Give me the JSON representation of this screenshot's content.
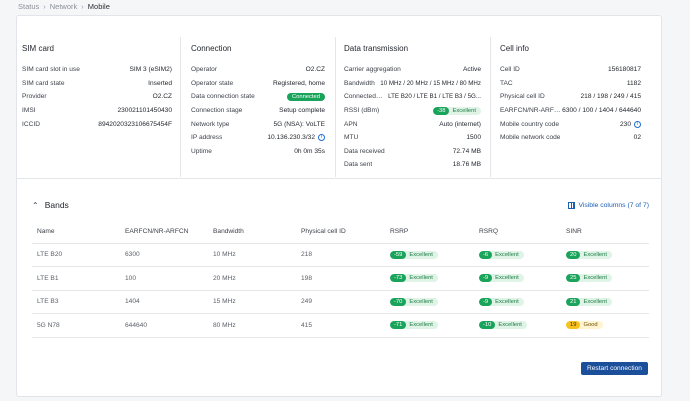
{
  "breadcrumb": [
    "Status",
    "Network",
    "Mobile"
  ],
  "sim": {
    "title": "SIM card",
    "rows": [
      {
        "k": "SIM card slot in use",
        "v": "SIM 3 (eSIM2)"
      },
      {
        "k": "SIM card state",
        "v": "Inserted"
      },
      {
        "k": "Provider",
        "v": "O2.CZ"
      },
      {
        "k": "IMSI",
        "v": "230021101450430"
      },
      {
        "k": "ICCID",
        "v": "8942020323106675454F"
      }
    ]
  },
  "connection": {
    "title": "Connection",
    "rows": [
      {
        "k": "Operator",
        "v": "O2.CZ"
      },
      {
        "k": "Operator state",
        "v": "Registered, home"
      },
      {
        "k": "Data connection state",
        "v": "Connected"
      },
      {
        "k": "Connection stage",
        "v": "Setup complete"
      },
      {
        "k": "Network type",
        "v": "5G (NSA): VoLTE"
      },
      {
        "k": "IP address",
        "v": "10.136.230.3/32"
      },
      {
        "k": "Uptime",
        "v": "0h 0m 35s"
      }
    ]
  },
  "transmission": {
    "title": "Data transmission",
    "rows": [
      {
        "k": "Carrier aggregation",
        "v": "Active"
      },
      {
        "k": "Bandwidth",
        "v": "10 MHz / 20 MHz / 15 MHz / 80 MHz"
      },
      {
        "k": "Connected b...",
        "v": "LTE B20 / LTE B1 / LTE B3 / 5G..."
      },
      {
        "k": "RSSI (dBm)",
        "v": "-38",
        "q": "Excellent"
      },
      {
        "k": "APN",
        "v": "Auto (internet)"
      },
      {
        "k": "MTU",
        "v": "1500"
      },
      {
        "k": "Data received",
        "v": "72.74 MB"
      },
      {
        "k": "Data sent",
        "v": "18.76 MB"
      }
    ]
  },
  "cell": {
    "title": "Cell info",
    "rows": [
      {
        "k": "Cell ID",
        "v": "156180817"
      },
      {
        "k": "TAC",
        "v": "1182"
      },
      {
        "k": "Physical cell ID",
        "v": "218 / 198 / 249 / 415"
      },
      {
        "k": "EARFCN/NR-ARFCN",
        "v": "6300 / 100 / 1404 / 644640"
      },
      {
        "k": "Mobile country code",
        "v": "230"
      },
      {
        "k": "Mobile network code",
        "v": "02"
      }
    ]
  },
  "bands": {
    "title": "Bands",
    "visible_columns": "Visible columns (7 of 7)",
    "headers": [
      "Name",
      "EARFCN/NR-ARFCN",
      "Bandwidth",
      "Physical cell ID",
      "RSRP",
      "RSRQ",
      "SINR"
    ],
    "rows": [
      {
        "name": "LTE B20",
        "earfcn": "6300",
        "bw": "10 MHz",
        "pci": "218",
        "rsrp": "-59",
        "rsrp_q": "Excellent",
        "rsrq": "-6",
        "rsrq_q": "Excellent",
        "sinr": "20",
        "sinr_q": "Excellent"
      },
      {
        "name": "LTE B1",
        "earfcn": "100",
        "bw": "20 MHz",
        "pci": "198",
        "rsrp": "-73",
        "rsrp_q": "Excellent",
        "rsrq": "-9",
        "rsrq_q": "Excellent",
        "sinr": "25",
        "sinr_q": "Excellent"
      },
      {
        "name": "LTE B3",
        "earfcn": "1404",
        "bw": "15 MHz",
        "pci": "249",
        "rsrp": "-70",
        "rsrp_q": "Excellent",
        "rsrq": "-9",
        "rsrq_q": "Excellent",
        "sinr": "21",
        "sinr_q": "Excellent"
      },
      {
        "name": "5G N78",
        "earfcn": "644640",
        "bw": "80 MHz",
        "pci": "415",
        "rsrp": "-71",
        "rsrp_q": "Excellent",
        "rsrq": "-10",
        "rsrq_q": "Excellent",
        "sinr": "19",
        "sinr_q": "Good"
      }
    ]
  },
  "restart_label": "Restart connection",
  "colors": {
    "accent": "#1b4f9a",
    "excellent": "#1aa35a",
    "good": "#f7c21d"
  }
}
